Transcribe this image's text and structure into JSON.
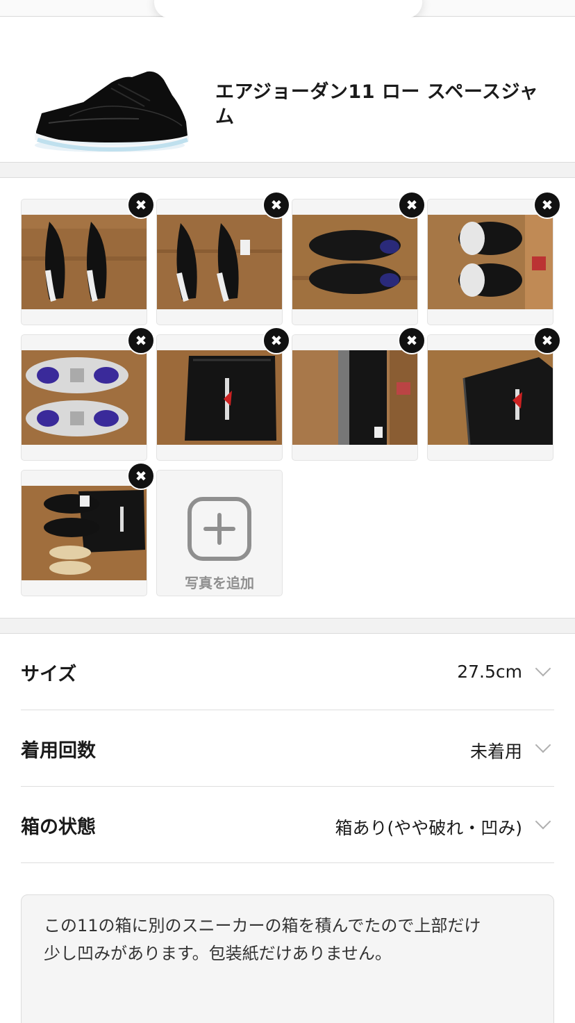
{
  "product": {
    "title": "エアジョーダン11 ロー スペースジャム",
    "image_icon": "sneaker-photo"
  },
  "photos": {
    "count": 9,
    "remove_icon": "close-icon",
    "remove_glyph": "✖",
    "add_label": "写真を追加",
    "add_icon": "plus-icon"
  },
  "fields": {
    "size": {
      "label": "サイズ",
      "value": "27.5cm"
    },
    "wear_count": {
      "label": "着用回数",
      "value": "未着用"
    },
    "box_condition": {
      "label": "箱の状態",
      "value": "箱あり(やや破れ・凹み)"
    }
  },
  "description": {
    "text": "この11の箱に別のスニーカーの箱を積んでたので上部だけ\n少し凹みがあります。包装紙だけありません。"
  },
  "colors": {
    "accent": "#111111",
    "muted": "#8f8f8f",
    "band": "#f2f2f2"
  }
}
